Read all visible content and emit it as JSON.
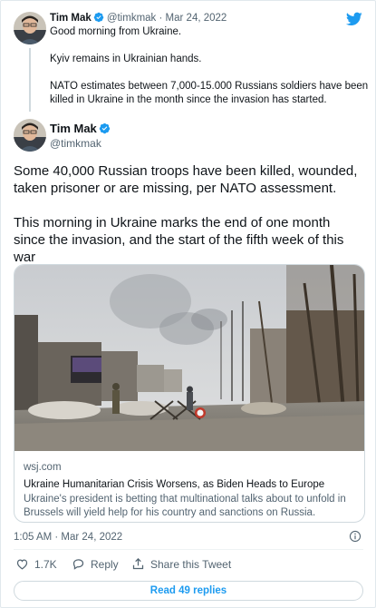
{
  "parent": {
    "name": "Tim Mak",
    "handle": "@timkmak",
    "separator": "·",
    "date": "Mar 24, 2022",
    "lines": [
      "Good morning from Ukraine.",
      "Kyiv remains in Ukrainian hands.",
      "NATO estimates between 7,000-15.000 Russians soldiers have been killed in Ukraine in the month since the invasion has started."
    ]
  },
  "tweet": {
    "name": "Tim Mak",
    "handle": "@timkmak",
    "paragraphs": [
      "Some 40,000 Russian troops have been killed, wounded, taken prisoner or are missing, per NATO assessment.",
      "This morning in Ukraine marks the end of one month since the invasion, and the start of the fifth week of this war"
    ],
    "timestamp": "1:05 AM · Mar 24, 2022"
  },
  "card": {
    "domain": "wsj.com",
    "title": "Ukraine Humanitarian Crisis Worsens, as Biden Heads to Europe",
    "description": "Ukraine's president is betting that multinational talks about to unfold in Brussels will yield help for his country and sanctions on Russia. President..."
  },
  "actions": {
    "likes": "1.7K",
    "reply": "Reply",
    "share": "Share this Tweet"
  },
  "replies_button": "Read 49 replies",
  "colors": {
    "accent": "#1d9bf0",
    "like": "#536471",
    "text": "#0f1419",
    "muted": "#536471",
    "border": "#cfd9de"
  },
  "icons": [
    "twitter-logo-icon",
    "verified-badge-icon",
    "info-icon",
    "heart-icon",
    "reply-icon",
    "share-icon"
  ]
}
